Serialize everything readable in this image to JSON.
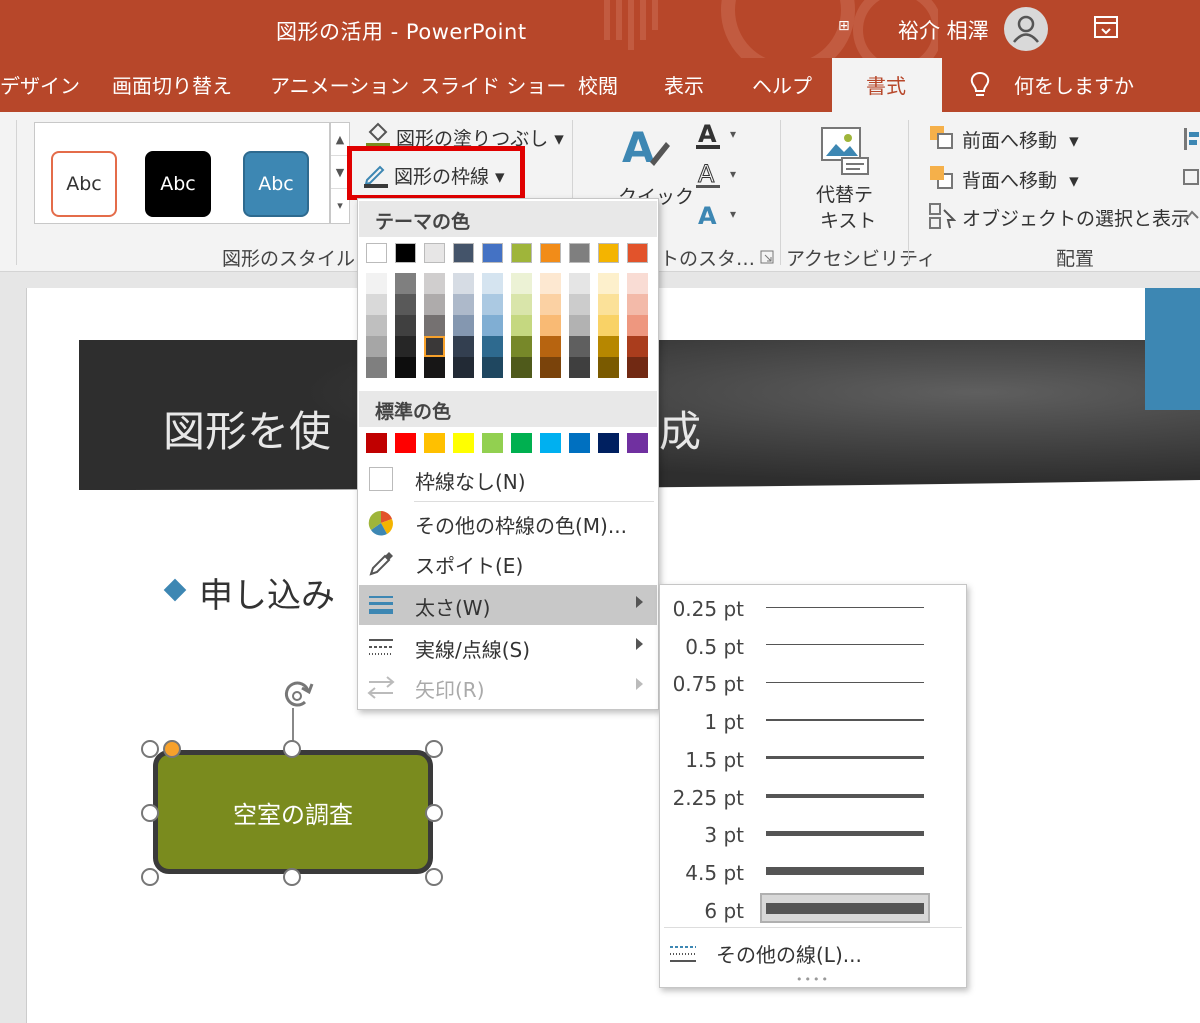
{
  "window": {
    "title": "図形の活用  -  PowerPoint",
    "user": "裕介 相澤"
  },
  "tabs": [
    {
      "label": "デザイン"
    },
    {
      "label": "画面切り替え"
    },
    {
      "label": "アニメーション"
    },
    {
      "label": "スライド ショー"
    },
    {
      "label": "校閲"
    },
    {
      "label": "表示"
    },
    {
      "label": "ヘルプ"
    },
    {
      "label": "書式",
      "active": true
    }
  ],
  "tell_me": "何をしますか",
  "ribbon": {
    "shape_styles": {
      "thumbs": [
        {
          "label": "Abc",
          "bg": "#ffffff",
          "fg": "#333333",
          "border": "#e46c4a"
        },
        {
          "label": "Abc",
          "bg": "#000000",
          "fg": "#ffffff",
          "border": "#000000"
        },
        {
          "label": "Abc",
          "bg": "#3d87b3",
          "fg": "#ffffff",
          "border": "#2e6a8f"
        }
      ],
      "fill_label": "図形の塗りつぶし",
      "outline_label": "図形の枠線",
      "group_label": "図形のスタイル"
    },
    "wordart": {
      "quick_label": "クイック",
      "group_label": "トのスタ…"
    },
    "accessibility": {
      "alt_text_line1": "代替テ",
      "alt_text_line2": "キスト",
      "group_label": "アクセシビリティ"
    },
    "arrange": {
      "bring_forward": "前面へ移動",
      "send_backward": "背面へ移動",
      "selection_pane": "オブジェクトの選択と表示",
      "group_label": "配置"
    }
  },
  "slide": {
    "title": "図形を使",
    "title_end": "成",
    "bullet": "申し込み",
    "shape_text": "空室の調査"
  },
  "outline_menu": {
    "theme_header": "テーマの色",
    "standard_header": "標準の色",
    "theme_top": [
      "#ffffff",
      "#000000",
      "#e7e6e6",
      "#44546a",
      "#4472c4",
      "#9fb53a",
      "#f28c18",
      "#7f7f7f",
      "#f4b400",
      "#e2532b"
    ],
    "theme_shades": [
      [
        "#f2f2f2",
        "#d9d9d9",
        "#bfbfbf",
        "#a6a6a6",
        "#7f7f7f"
      ],
      [
        "#7f7f7f",
        "#595959",
        "#404040",
        "#262626",
        "#0d0d0d"
      ],
      [
        "#d0cece",
        "#aeabab",
        "#757171",
        "#3a3838",
        "#171616"
      ],
      [
        "#d6dce4",
        "#adb9ca",
        "#8497b0",
        "#333f50",
        "#222a35"
      ],
      [
        "#d5e4f0",
        "#abc9e2",
        "#80aed3",
        "#2e6a8f",
        "#1f4760"
      ],
      [
        "#ecf2d5",
        "#d9e5aa",
        "#c5d880",
        "#778829",
        "#4f5a1b"
      ],
      [
        "#fde8d1",
        "#fbd1a3",
        "#f9ba74",
        "#b76410",
        "#7a430b"
      ],
      [
        "#e5e5e5",
        "#cccccc",
        "#b2b2b2",
        "#5f5f5f",
        "#3f3f3f"
      ],
      [
        "#fdf0cc",
        "#fbe199",
        "#f9d266",
        "#b78700",
        "#7a5a00"
      ],
      [
        "#f9dcd4",
        "#f3baa9",
        "#ee977f",
        "#aa3d1d",
        "#712913"
      ]
    ],
    "standard": [
      "#c00000",
      "#ff0000",
      "#ffc000",
      "#ffff00",
      "#92d050",
      "#00b050",
      "#00b0f0",
      "#0070c0",
      "#002060",
      "#7030a0"
    ],
    "no_outline": "枠線なし(N)",
    "more_colors": "その他の枠線の色(M)...",
    "eyedropper": "スポイト(E)",
    "weight": "太さ(W)",
    "dashes": "実線/点線(S)",
    "arrows": "矢印(R)"
  },
  "weight_menu": {
    "options": [
      {
        "label": "0.25 pt",
        "thickness": 0.25
      },
      {
        "label": "0.5 pt",
        "thickness": 0.5
      },
      {
        "label": "0.75 pt",
        "thickness": 0.75
      },
      {
        "label": "1 pt",
        "thickness": 1
      },
      {
        "label": "1.5 pt",
        "thickness": 1.5
      },
      {
        "label": "2.25 pt",
        "thickness": 2.25
      },
      {
        "label": "3 pt",
        "thickness": 3
      },
      {
        "label": "4.5 pt",
        "thickness": 4.5
      },
      {
        "label": "6 pt",
        "thickness": 6,
        "selected": true
      }
    ],
    "more_lines": "その他の線(L)..."
  }
}
